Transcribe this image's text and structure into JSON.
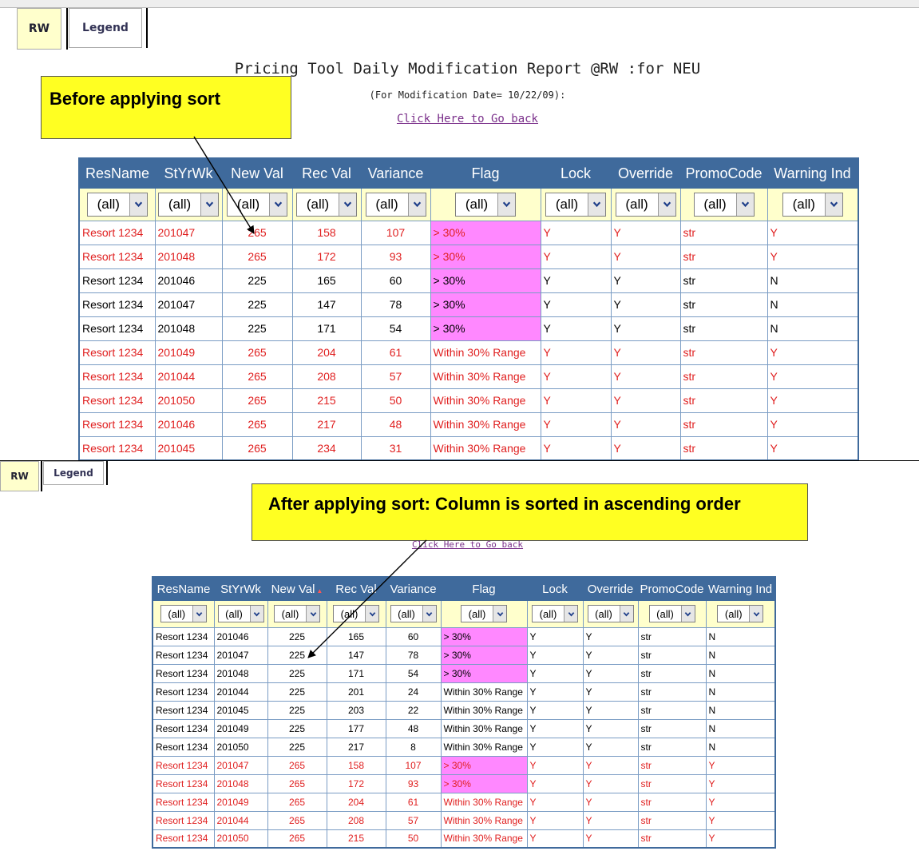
{
  "tabs": {
    "rw": "RW",
    "legend": "Legend"
  },
  "report": {
    "title": "Pricing Tool Daily Modification Report @RW :for NEU",
    "subtitle": "(For Modification Date= 10/22/09):",
    "go_back": "Click Here to Go back"
  },
  "callouts": {
    "before": "Before applying sort",
    "after": "After applying sort: Column is sorted  in  ascending  order"
  },
  "columns": [
    "ResName",
    "StYrWk",
    "New Val",
    "Rec Val",
    "Variance",
    "Flag",
    "Lock",
    "Override",
    "PromoCode",
    "Warning Ind"
  ],
  "sort_indicator": "▲",
  "filter_value": "(all)",
  "filter_arrow_icon": "chevron-down-icon",
  "colors": {
    "header_bg": "#3f6a9c",
    "filter_bg": "#ffffcc",
    "flag_highlight": "#ff88ff",
    "warning_text": "#e02020",
    "callout_bg": "#ffff22",
    "link": "#7a2f8a"
  },
  "before_rows": [
    [
      "Resort 1234",
      "201047",
      "265",
      "158",
      "107",
      "> 30%",
      "Y",
      "Y",
      "str",
      "Y"
    ],
    [
      "Resort 1234",
      "201048",
      "265",
      "172",
      "93",
      "> 30%",
      "Y",
      "Y",
      "str",
      "Y"
    ],
    [
      "Resort 1234",
      "201046",
      "225",
      "165",
      "60",
      "> 30%",
      "Y",
      "Y",
      "str",
      "N"
    ],
    [
      "Resort 1234",
      "201047",
      "225",
      "147",
      "78",
      "> 30%",
      "Y",
      "Y",
      "str",
      "N"
    ],
    [
      "Resort 1234",
      "201048",
      "225",
      "171",
      "54",
      "> 30%",
      "Y",
      "Y",
      "str",
      "N"
    ],
    [
      "Resort 1234",
      "201049",
      "265",
      "204",
      "61",
      "Within 30% Range",
      "Y",
      "Y",
      "str",
      "Y"
    ],
    [
      "Resort 1234",
      "201044",
      "265",
      "208",
      "57",
      "Within 30% Range",
      "Y",
      "Y",
      "str",
      "Y"
    ],
    [
      "Resort 1234",
      "201050",
      "265",
      "215",
      "50",
      "Within 30% Range",
      "Y",
      "Y",
      "str",
      "Y"
    ],
    [
      "Resort 1234",
      "201046",
      "265",
      "217",
      "48",
      "Within 30% Range",
      "Y",
      "Y",
      "str",
      "Y"
    ],
    [
      "Resort 1234",
      "201045",
      "265",
      "234",
      "31",
      "Within 30% Range",
      "Y",
      "Y",
      "str",
      "Y"
    ]
  ],
  "after_rows": [
    [
      "Resort 1234",
      "201046",
      "225",
      "165",
      "60",
      "> 30%",
      "Y",
      "Y",
      "str",
      "N"
    ],
    [
      "Resort 1234",
      "201047",
      "225",
      "147",
      "78",
      "> 30%",
      "Y",
      "Y",
      "str",
      "N"
    ],
    [
      "Resort 1234",
      "201048",
      "225",
      "171",
      "54",
      "> 30%",
      "Y",
      "Y",
      "str",
      "N"
    ],
    [
      "Resort 1234",
      "201044",
      "225",
      "201",
      "24",
      "Within 30% Range",
      "Y",
      "Y",
      "str",
      "N"
    ],
    [
      "Resort 1234",
      "201045",
      "225",
      "203",
      "22",
      "Within 30% Range",
      "Y",
      "Y",
      "str",
      "N"
    ],
    [
      "Resort 1234",
      "201049",
      "225",
      "177",
      "48",
      "Within 30% Range",
      "Y",
      "Y",
      "str",
      "N"
    ],
    [
      "Resort 1234",
      "201050",
      "225",
      "217",
      "8",
      "Within 30% Range",
      "Y",
      "Y",
      "str",
      "N"
    ],
    [
      "Resort 1234",
      "201047",
      "265",
      "158",
      "107",
      "> 30%",
      "Y",
      "Y",
      "str",
      "Y"
    ],
    [
      "Resort 1234",
      "201048",
      "265",
      "172",
      "93",
      "> 30%",
      "Y",
      "Y",
      "str",
      "Y"
    ],
    [
      "Resort 1234",
      "201049",
      "265",
      "204",
      "61",
      "Within 30% Range",
      "Y",
      "Y",
      "str",
      "Y"
    ],
    [
      "Resort 1234",
      "201044",
      "265",
      "208",
      "57",
      "Within 30% Range",
      "Y",
      "Y",
      "str",
      "Y"
    ],
    [
      "Resort 1234",
      "201050",
      "265",
      "215",
      "50",
      "Within 30% Range",
      "Y",
      "Y",
      "str",
      "Y"
    ]
  ]
}
